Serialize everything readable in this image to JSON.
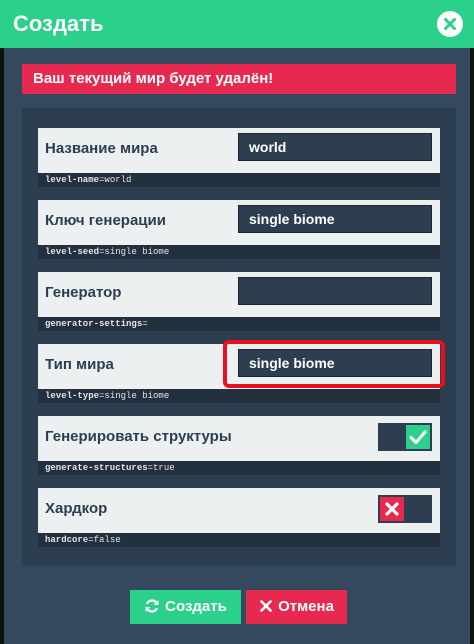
{
  "window": {
    "title": "Создать"
  },
  "warning": {
    "text": "Ваш текущий мир будет удалён!"
  },
  "settings": [
    {
      "label": "Название мира",
      "key": "level-name",
      "sep": "=",
      "key_value": "world",
      "type": "text",
      "value": "world"
    },
    {
      "label": "Ключ генерации",
      "key": "level-seed",
      "sep": "=",
      "key_value": "single biome",
      "type": "text",
      "value": "single biome"
    },
    {
      "label": "Генератор",
      "key": "generator-settings",
      "sep": "=",
      "key_value": "",
      "type": "text",
      "value": ""
    },
    {
      "label": "Тип мира",
      "key": "level-type",
      "sep": "=",
      "key_value": "single biome",
      "type": "text",
      "value": "single biome"
    },
    {
      "label": "Генерировать структуры",
      "key": "generate-structures",
      "sep": "=",
      "key_value": "true",
      "type": "toggle",
      "value": "true"
    },
    {
      "label": "Хардкор",
      "key": "hardcore",
      "sep": "=",
      "key_value": "false",
      "type": "toggle",
      "value": "false"
    }
  ],
  "buttons": {
    "create_label": "Создать",
    "cancel_label": "Отмена"
  },
  "icons": {
    "close": "close-icon",
    "create": "refresh-icon",
    "cancel": "x-icon",
    "toggle_on": "checkmark-icon",
    "toggle_off": "x-icon"
  },
  "colors": {
    "accent_green": "#2bd18b",
    "danger_red": "#e7294f",
    "dialog_bg": "#34495e",
    "panel_bg": "#2c3e50",
    "row_bg": "#ecf0f1",
    "highlight_red": "#e8101c"
  }
}
